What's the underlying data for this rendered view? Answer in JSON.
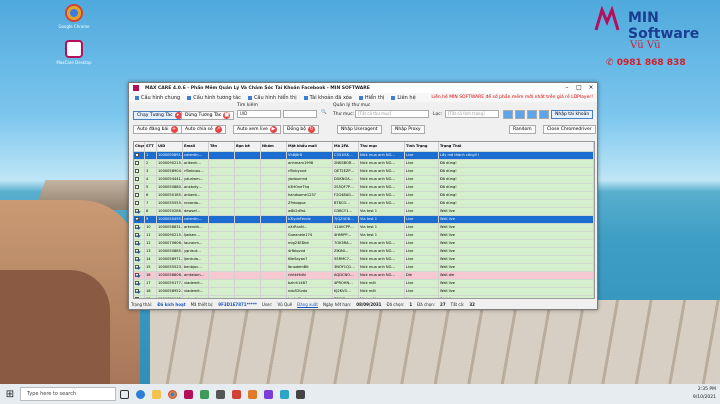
{
  "desktop": {
    "icons": [
      {
        "label": "Google Chrome",
        "color": "#e0a32c"
      },
      {
        "label": "MaxCare Desktop",
        "color": "#b30f5a"
      }
    ]
  },
  "brand": {
    "name": "MIN Software",
    "owner": "Vũ Vũ",
    "phone": "0981 868 838"
  },
  "app": {
    "title": "MAX CARE 4.0.6 - Phần Mềm Quản Lý Và Chăm Sóc Tài Khoản Facebook - MIN SOFTWARE",
    "menu": [
      "Cấu hình chung",
      "Cấu hình tương tác",
      "Cấu hình hiển thị",
      "Tài khoản đã xóa",
      "Hiển thị",
      "Liên hệ"
    ],
    "notice": "Liên hệ MIN SOFTWARE để sở phần mềm mới nhất trên giá rẻ LDPlayer!",
    "toolbar": {
      "chay": "Chạy Tương Tác",
      "dung": "Dừng Tương Tác",
      "tim_kiem": "Tìm kiếm",
      "uid": "UID",
      "quan_ly": "Quản lý thư mục",
      "thu_muc": "Thư mục:",
      "thu_muc_ph": "[Tất cả thư mục]",
      "loc": "Lọc:",
      "loc_ph": "[Tất cả tình trạng]",
      "nhap_tk": "Nhập tài khoản",
      "add_bai": "Auto đăng bài",
      "add_chia_se": "Auto chia sẻ",
      "add_xem_live": "Auto xem live",
      "dong_bo": "Đồng bộ",
      "nhap_useragent": "Nhập Useragent",
      "nhap_proxy": "Nhập Proxy",
      "random": "Random",
      "close_chrome": "Close Chromedriver"
    },
    "columns": [
      "Chọn",
      "STT",
      "UID",
      "Email",
      "Tên",
      "Bạn bè",
      "Nhóm",
      "Mật khẩu mail",
      "Mã 2FA",
      "Thư mục",
      "Tình Trạng",
      "Trạng Thái"
    ],
    "rows": [
      {
        "stt": "1",
        "uid": "1000095891…",
        "email": "valentin…",
        "mk": "Vh8j8r8",
        "fa": "C331ISK…",
        "tm": "Nick mua anh NG…",
        "tt": "Live",
        "st": "Lấy mã thành công!!!",
        "c": "sel",
        "chk": false
      },
      {
        "stt": "2",
        "uid": "1000090215…",
        "email": "arikenh…",
        "mk": "anhmam1998",
        "fa": "2NKSBOR…",
        "tm": "Nick mua anh NG…",
        "tt": "Live",
        "st": "Đã dừng!",
        "c": "g",
        "chk": false
      },
      {
        "stt": "3",
        "uid": "1000058904…",
        "email": "rf5ebnau…",
        "mk": "rf5nbyxnd",
        "fa": "QET2EZP…",
        "tm": "Nick mua anh NG…",
        "tt": "Live",
        "st": "Đã dừng!",
        "c": "g",
        "chk": false
      },
      {
        "stt": "4",
        "uid": "1000054441…",
        "email": "ydurlwm…",
        "mk": "ybdoumnd",
        "fa": "DUKNOA…",
        "tm": "Nick mua anh NG…",
        "tt": "Live",
        "st": "Đã dừng!",
        "c": "g",
        "chk": false
      },
      {
        "stt": "5",
        "uid": "1000050880…",
        "email": "anxbvty…",
        "mk": "k3HOneThq",
        "fa": "2S5QF7P…",
        "tm": "Nick mua anh NG…",
        "tt": "Live",
        "st": "Đã dừng!",
        "c": "g",
        "chk": false
      },
      {
        "stt": "6",
        "uid": "1000050185…",
        "email": "anberb…",
        "mk": "handsome1237",
        "fa": "F2G48AG…",
        "tm": "Nick mua anh NG…",
        "tt": "Live",
        "st": "Đã dừng!",
        "c": "g",
        "chk": false
      },
      {
        "stt": "7",
        "uid": "1000055555…",
        "email": "ronarda…",
        "mk": "Z9rbqqua",
        "fa": "BT8CO…",
        "tm": "Nick mua anh NG…",
        "tt": "Live",
        "st": "Đã dừng!",
        "c": "g",
        "chk": false
      },
      {
        "stt": "8",
        "uid": "1000050286…",
        "email": "dewsef…",
        "mk": "w8k2dYaL",
        "fa": "G3BCY1…",
        "tm": "Via test 1",
        "tt": "Live",
        "st": "Wall live",
        "c": "g",
        "chk": true
      },
      {
        "stt": "9",
        "uid": "1000050495…",
        "email": "valentin…",
        "mk": "k3lydnFendz",
        "fa": "7JQZ4OB…",
        "tm": "Via test 1",
        "tt": "Live",
        "st": "Wall live",
        "c": "sel",
        "chk": true
      },
      {
        "stt": "10",
        "uid": "1000058831…",
        "email": "arkeroth…",
        "mk": "xXrRnxN…",
        "fa": "11AVCPP…",
        "tm": "Via test 1",
        "tt": "Live",
        "st": "Wall live",
        "c": "g",
        "chk": true
      },
      {
        "stt": "11",
        "uid": "1000090215…",
        "email": "ljwisen…",
        "mk": "Gueanele174",
        "fa": "4HMIPP…",
        "tm": "Via test 1",
        "tt": "Live",
        "st": "Wall live",
        "c": "g",
        "chk": true
      },
      {
        "stt": "12",
        "uid": "1000070606…",
        "email": "lauranm…",
        "mk": "mig23EDbh",
        "fa": "7OK5RA…",
        "tm": "Nick mua anh NG…",
        "tt": "Live",
        "st": "Wall live",
        "c": "g",
        "chk": true
      },
      {
        "stt": "13",
        "uid": "1000050885…",
        "email": "ygnisut…",
        "mk": "4rfblqvnd",
        "fa": "ZIKINI…",
        "tm": "Nick mua anh NG…",
        "tt": "Live",
        "st": "Wall live",
        "c": "g",
        "chk": true
      },
      {
        "stt": "14",
        "uid": "1000058971…",
        "email": "ljenkula…",
        "mk": "tBeSayon7",
        "fa": "5SRMC7…",
        "tm": "Nick mua anh NG…",
        "tt": "Live",
        "st": "Wall live",
        "c": "g",
        "chk": true
      },
      {
        "stt": "15",
        "uid": "1000055523…",
        "email": "benbjoc…",
        "mk": "IbnodemBit",
        "fa": "3NOY1Q1…",
        "tm": "Nick mua anh NG…",
        "tt": "Live",
        "st": "Wall live",
        "c": "g",
        "chk": true
      },
      {
        "stt": "16",
        "uid": "1000058806…",
        "email": "amkelam…",
        "mk": "rtlrtkHldhl",
        "fa": "AQDCNO…",
        "tm": "Nick mua anh NG…",
        "tt": "Die",
        "st": "Wall die",
        "c": "pk",
        "chk": true
      },
      {
        "stt": "17",
        "uid": "1000059177…",
        "email": "vlademit…",
        "mk": "bzhrh1487",
        "fa": "4PROHN…",
        "tm": "Nick mới",
        "tt": "Live",
        "st": "Wall live",
        "c": "g",
        "chk": true
      },
      {
        "stt": "18",
        "uid": "1000058952…",
        "email": "vlademit…",
        "mk": "ndo52tvdo",
        "fa": "KJ2KVO…",
        "tm": "Nick mới",
        "tt": "Live",
        "st": "Wall live",
        "c": "g",
        "chk": true
      },
      {
        "stt": "19",
        "uid": "1000059143…",
        "email": "vakentin…",
        "mk": "kgdyd1vdo",
        "fa": "PSIMO…",
        "tm": "Nick mới",
        "tt": "Live",
        "st": "Wall live",
        "c": "g",
        "chk": true
      }
    ],
    "status": {
      "trang_thai": "Trạng thái:",
      "trang_thai_v": "Đã kích hoạt",
      "ma_thiet_bi": "Mã thiết bị:",
      "ma_thiet_bi_v": "9F3D1E7871*****",
      "user": "User:",
      "user_v": "Vũ Quế",
      "dang_xuat": "Đăng xuất",
      "ngay_het_han": "Ngày hết hạn:",
      "ngay_het_han_v": "08/09/2031",
      "da_chon": "Đã chọn:",
      "da_chon_v": "1",
      "hien_thi": "Hiển thị:",
      "hien_thi_v": "27",
      "tat_ca": "Tất cả:",
      "tat_ca_v": "32",
      "bi_chan": "Đã chọn:",
      "bi_chan_v": "27"
    }
  },
  "taskbar": {
    "search": "Type here to search",
    "time": "2:35 PM",
    "date": "9/10/2021"
  }
}
